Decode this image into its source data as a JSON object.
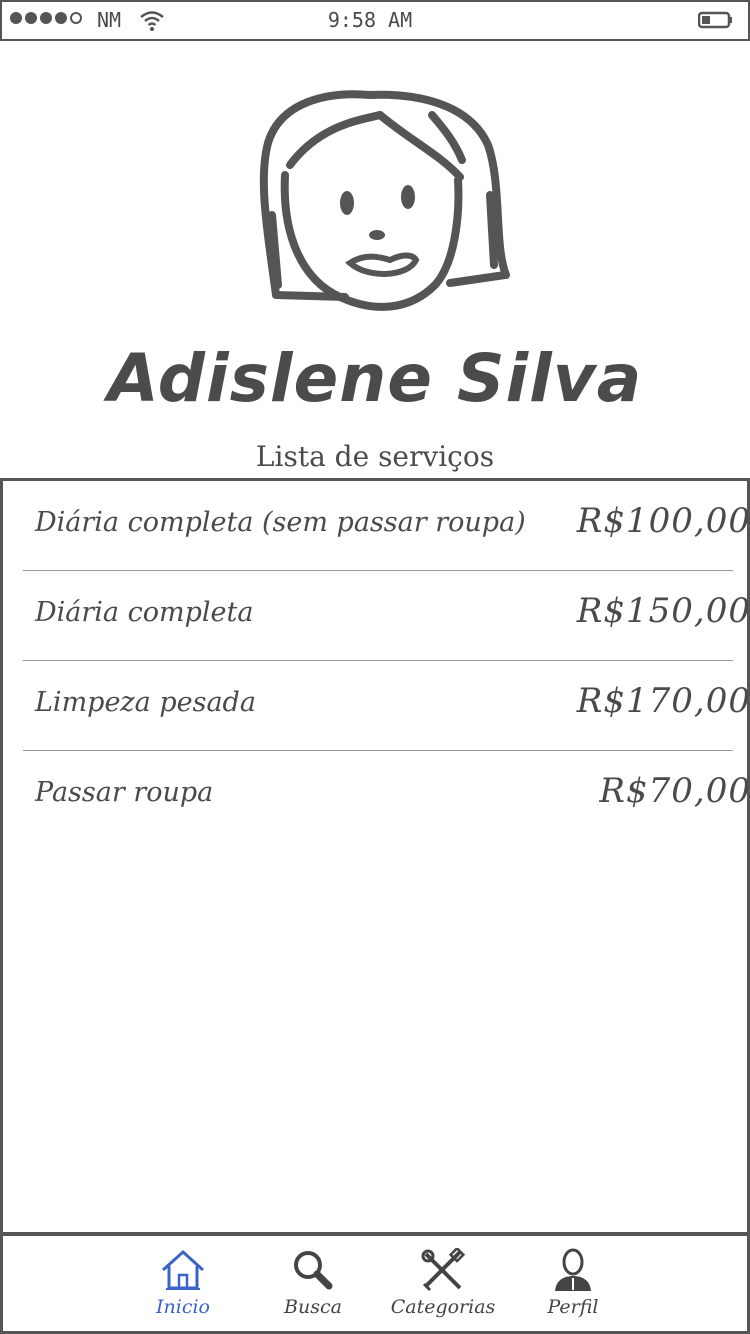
{
  "status_bar": {
    "carrier": "NM",
    "time": "9:58 AM"
  },
  "profile": {
    "name": "Adislene Silva",
    "section_title": "Lista de serviços"
  },
  "services": [
    {
      "name": "Diária completa (sem passar roupa)",
      "price": "R$100,00"
    },
    {
      "name": "Diária completa",
      "price": "R$150,00"
    },
    {
      "name": "Limpeza pesada",
      "price": "R$170,00"
    },
    {
      "name": "Passar roupa",
      "price": "R$70,00"
    }
  ],
  "tab_bar": {
    "tabs": [
      {
        "label": "Inicio",
        "icon": "home-icon",
        "active": true
      },
      {
        "label": "Busca",
        "icon": "search-icon",
        "active": false
      },
      {
        "label": "Categorias",
        "icon": "tools-icon",
        "active": false
      },
      {
        "label": "Perfil",
        "icon": "person-icon",
        "active": false
      }
    ]
  },
  "colors": {
    "ink": "#4a4a4a",
    "border": "#555555",
    "active_tab": "#3a63c7"
  }
}
